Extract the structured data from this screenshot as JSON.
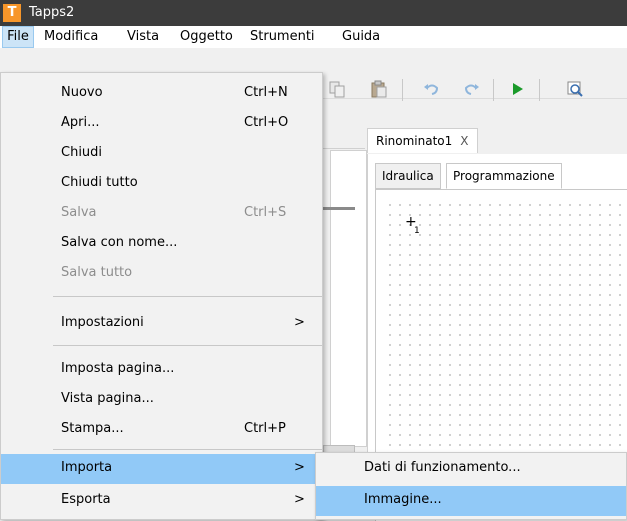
{
  "window": {
    "title": "Tapps2",
    "app_icon_letter": "T"
  },
  "menubar": [
    "File",
    "Modifica",
    "Vista",
    "Oggetto",
    "Strumenti",
    "Guida"
  ],
  "file_menu": [
    {
      "label": "Nuovo",
      "shortcut": "Ctrl+N",
      "disabled": false
    },
    {
      "label": "Apri...",
      "shortcut": "Ctrl+O",
      "disabled": false
    },
    {
      "label": "Chiudi",
      "shortcut": "",
      "disabled": false
    },
    {
      "label": "Chiudi tutto",
      "shortcut": "",
      "disabled": false
    },
    {
      "label": "Salva",
      "shortcut": "Ctrl+S",
      "disabled": true
    },
    {
      "label": "Salva con nome...",
      "shortcut": "",
      "disabled": false
    },
    {
      "label": "Salva tutto",
      "shortcut": "",
      "disabled": true
    },
    {
      "label": "Impostazioni",
      "shortcut": "",
      "arrow": ">",
      "disabled": false
    },
    {
      "label": "Imposta pagina...",
      "shortcut": "",
      "disabled": false
    },
    {
      "label": "Vista pagina...",
      "shortcut": "",
      "disabled": false
    },
    {
      "label": "Stampa...",
      "shortcut": "Ctrl+P",
      "disabled": false
    },
    {
      "label": "Importa",
      "shortcut": "",
      "arrow": ">",
      "disabled": false,
      "highlighted": true
    },
    {
      "label": "Esporta",
      "shortcut": "",
      "arrow": ">",
      "disabled": false
    }
  ],
  "import_submenu": [
    {
      "label": "Dati di funzionamento...",
      "highlighted": false
    },
    {
      "label": "Immagine...",
      "highlighted": true
    }
  ],
  "document": {
    "tab_label": "Rinominato1",
    "tab_close": "X",
    "subtabs": [
      "Idraulica",
      "Programmazione"
    ],
    "active_subtab": "Programmazione",
    "grid_origin_marker": "+",
    "grid_origin_label": "1"
  },
  "colors": {
    "titlebar": "#3c3c3c",
    "app_icon": "#f7962a",
    "menu_highlight": "#91c9f7",
    "menubar_active": "#cce4f7"
  },
  "toolbar_icons": [
    "copy-icon",
    "paste-icon",
    "undo-icon",
    "redo-icon",
    "run-icon",
    "zoom-icon"
  ]
}
